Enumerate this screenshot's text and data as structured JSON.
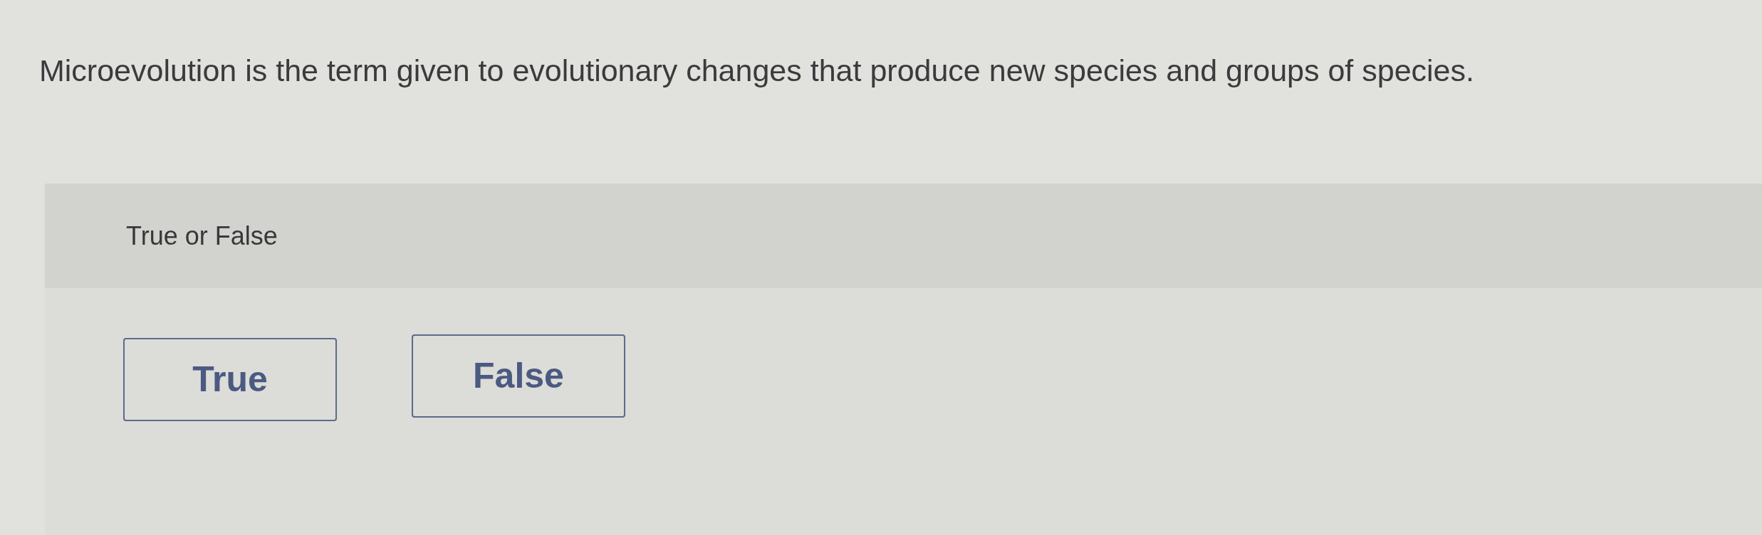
{
  "question": {
    "text": "Microevolution is the term given to evolutionary changes that produce new species and groups of species."
  },
  "answer_panel": {
    "label": "True or False",
    "options": [
      {
        "label": "True",
        "selected": false
      },
      {
        "label": "False",
        "selected": false
      }
    ]
  }
}
